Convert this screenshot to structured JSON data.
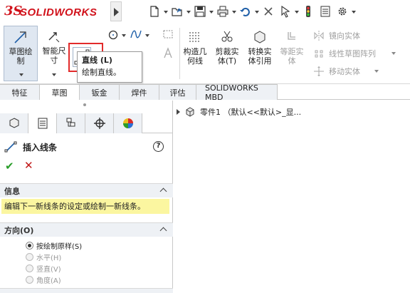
{
  "app": {
    "logo_ds": "3S",
    "logo_name": "SOLIDWORKS"
  },
  "quick_access": {
    "icons": [
      "new-document-icon",
      "open-icon",
      "save-icon",
      "print-icon",
      "undo-icon",
      "close-icon",
      "select-icon",
      "traffic-light-icon",
      "file-properties-icon",
      "options-gear-icon"
    ]
  },
  "ribbon": {
    "sketch": "草图绘\n制",
    "smart_dimension": "智能尺\n寸",
    "construct_geometry": "构造几\n何线",
    "trim_entities": "剪裁实\n体(T)",
    "convert_entities": "转换实\n体引用",
    "offset_entities": "等距实\n体",
    "mirror_entities": "镜向实体",
    "linear_pattern": "线性草图阵列",
    "move_entities": "移动实体"
  },
  "tooltip": {
    "title": "直线   (L)",
    "description": "绘制直线。"
  },
  "tabs": [
    "特征",
    "草图",
    "钣金",
    "焊件",
    "评估",
    "SOLIDWORKS MBD"
  ],
  "active_tab": "草图",
  "property_manager": {
    "title": "插入线条",
    "help": "?",
    "info_header": "信息",
    "info_message": "编辑下一新线条的设定或绘制一新线条。",
    "orientation_header": "方向(O)",
    "options": [
      {
        "label": "按绘制原样(S)",
        "selected": true,
        "enabled": true
      },
      {
        "label": "水平(H)",
        "selected": false,
        "enabled": false
      },
      {
        "label": "竖直(V)",
        "selected": false,
        "enabled": false
      },
      {
        "label": "角度(A)",
        "selected": false,
        "enabled": false
      }
    ]
  },
  "tree": {
    "root_label": "零件1 （默认<<默认>_显..."
  },
  "colors": {
    "brand_red": "#d1121b",
    "highlight_red": "#e22b2b",
    "info_yellow": "#fbf6a0",
    "ok_green": "#2a9d2a",
    "cancel_red": "#c01818"
  }
}
